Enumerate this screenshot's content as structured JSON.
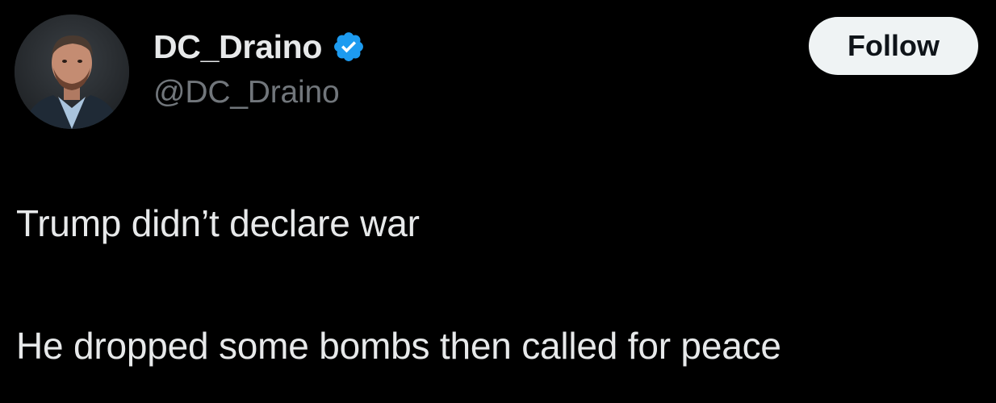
{
  "tweet": {
    "author": {
      "display_name": "DC_Draino",
      "handle": "@DC_Draino",
      "verified": true,
      "verified_icon": "verified-badge-icon"
    },
    "follow_label": "Follow",
    "lines": [
      "Trump didn’t declare war",
      "He dropped some bombs then called for peace"
    ]
  },
  "colors": {
    "background": "#000000",
    "primary_text": "#e7e9ea",
    "secondary_text": "#71767b",
    "verified_blue": "#1d9bf0",
    "follow_button_bg": "#eff3f4",
    "follow_button_text": "#0f1419"
  }
}
